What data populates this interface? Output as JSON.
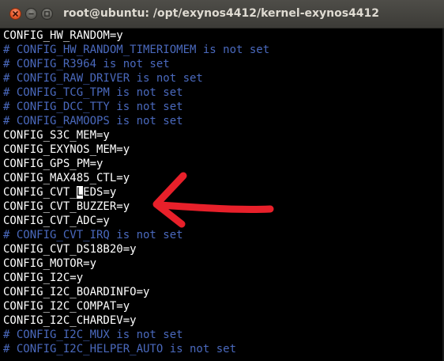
{
  "window": {
    "title": "root@ubuntu: /opt/exynos4412/kernel-exynos4412",
    "controls": [
      "close-icon",
      "minimize-icon",
      "maximize-icon"
    ]
  },
  "terminal": {
    "lines": [
      {
        "text": "CONFIG_HW_RANDOM=y",
        "type": "plain"
      },
      {
        "text": "# CONFIG_HW_RANDOM_TIMERIOMEM is not set",
        "type": "comment"
      },
      {
        "text": "# CONFIG_R3964 is not set",
        "type": "comment"
      },
      {
        "text": "# CONFIG_RAW_DRIVER is not set",
        "type": "comment"
      },
      {
        "text": "# CONFIG_TCG_TPM is not set",
        "type": "comment"
      },
      {
        "text": "# CONFIG_DCC_TTY is not set",
        "type": "comment"
      },
      {
        "text": "# CONFIG_RAMOOPS is not set",
        "type": "comment"
      },
      {
        "text": "CONFIG_S3C_MEM=y",
        "type": "plain"
      },
      {
        "text": "CONFIG_EXYNOS_MEM=y",
        "type": "plain"
      },
      {
        "text": "CONFIG_GPS_PM=y",
        "type": "plain"
      },
      {
        "text": "CONFIG_MAX485_CTL=y",
        "type": "plain"
      },
      {
        "text": "CONFIG_CVT_LEDS=y",
        "type": "plain",
        "cursor_at": 11
      },
      {
        "text": "CONFIG_CVT_BUZZER=y",
        "type": "plain"
      },
      {
        "text": "CONFIG_CVT_ADC=y",
        "type": "plain"
      },
      {
        "text": "# CONFIG_CVT_IRQ is not set",
        "type": "comment"
      },
      {
        "text": "CONFIG_CVT_DS18B20=y",
        "type": "plain"
      },
      {
        "text": "CONFIG_MOTOR=y",
        "type": "plain"
      },
      {
        "text": "CONFIG_I2C=y",
        "type": "plain"
      },
      {
        "text": "CONFIG_I2C_BOARDINFO=y",
        "type": "plain"
      },
      {
        "text": "CONFIG_I2C_COMPAT=y",
        "type": "plain"
      },
      {
        "text": "CONFIG_I2C_CHARDEV=y",
        "type": "plain"
      },
      {
        "text": "# CONFIG_I2C_MUX is not set",
        "type": "comment"
      },
      {
        "text": "# CONFIG_I2C_HELPER_AUTO is not set",
        "type": "comment"
      }
    ]
  },
  "annotation": {
    "type": "arrow",
    "color": "#e8202a",
    "points_to_line": 12
  },
  "colors": {
    "background": "#000000",
    "plain_text": "#ffffff",
    "comment_text": "#4a69bd",
    "titlebar": "#3c3b37",
    "close_button": "#e8592a"
  }
}
